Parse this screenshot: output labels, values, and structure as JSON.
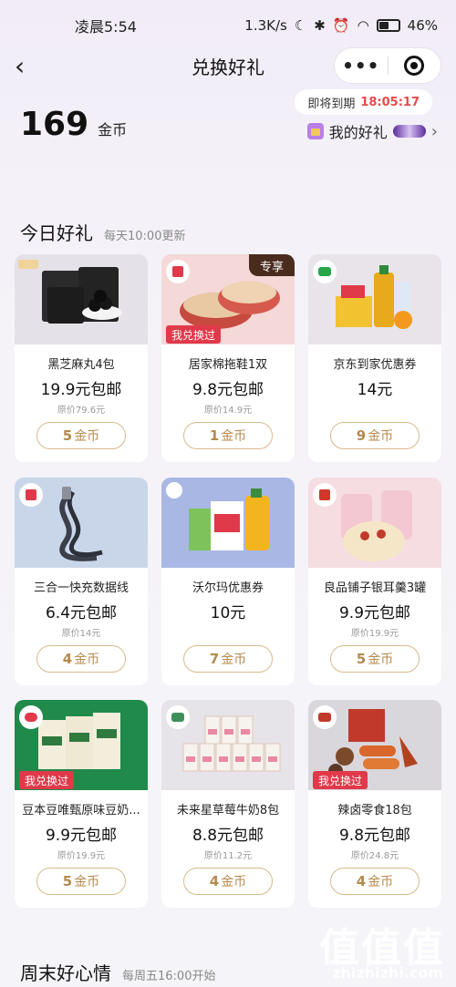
{
  "status_bar": {
    "time": "凌晨5:54",
    "speed": "1.3K/s",
    "battery": "46%"
  },
  "nav": {
    "back": "‹",
    "title": "兑换好礼",
    "more": "•••"
  },
  "wallet": {
    "coins": "169",
    "unit": "金币"
  },
  "expire": {
    "label": "即将到期",
    "time": "18:05:17"
  },
  "my_gift": {
    "label": "我的好礼",
    "chevron": "›"
  },
  "today": {
    "title": "今日好礼",
    "subtitle": "每天10:00更新"
  },
  "weekend": {
    "title": "周末好心情",
    "subtitle": "每周五16:00开始"
  },
  "products": [
    {
      "name": "黑芝麻丸4包",
      "price": "19.9元包邮",
      "original": "原价79.6元",
      "coins": "5",
      "coin_unit": "金币"
    },
    {
      "name": "居家棉拖鞋1双",
      "price": "9.8元包邮",
      "original": "原价14.9元",
      "coins": "1",
      "coin_unit": "金币",
      "tag": "专享",
      "badge": "我兑换过"
    },
    {
      "name": "京东到家优惠券",
      "price": "14元",
      "original": "",
      "coins": "9",
      "coin_unit": "金币"
    },
    {
      "name": "三合一快充数据线",
      "price": "6.4元包邮",
      "original": "原价14元",
      "coins": "4",
      "coin_unit": "金币"
    },
    {
      "name": "沃尔玛优惠券",
      "price": "10元",
      "original": "",
      "coins": "7",
      "coin_unit": "金币"
    },
    {
      "name": "良品铺子银耳羹3罐",
      "price": "9.9元包邮",
      "original": "原价19.9元",
      "coins": "5",
      "coin_unit": "金币"
    },
    {
      "name": "豆本豆唯甄原味豆奶...",
      "price": "9.9元包邮",
      "original": "原价19.9元",
      "coins": "5",
      "coin_unit": "金币",
      "badge": "我兑换过"
    },
    {
      "name": "未来星草莓牛奶8包",
      "price": "8.8元包邮",
      "original": "原价11.2元",
      "coins": "4",
      "coin_unit": "金币"
    },
    {
      "name": "辣卤零食18包",
      "price": "9.8元包邮",
      "original": "原价24.8元",
      "coins": "4",
      "coin_unit": "金币",
      "badge": "我兑换过"
    }
  ],
  "watermark": {
    "logo": "值值值",
    "url": "zhizhizhi.com"
  },
  "colors": {
    "accent_gold": "#b58a4e",
    "badge_red": "#e0394a",
    "timer_red": "#e84a4a"
  }
}
